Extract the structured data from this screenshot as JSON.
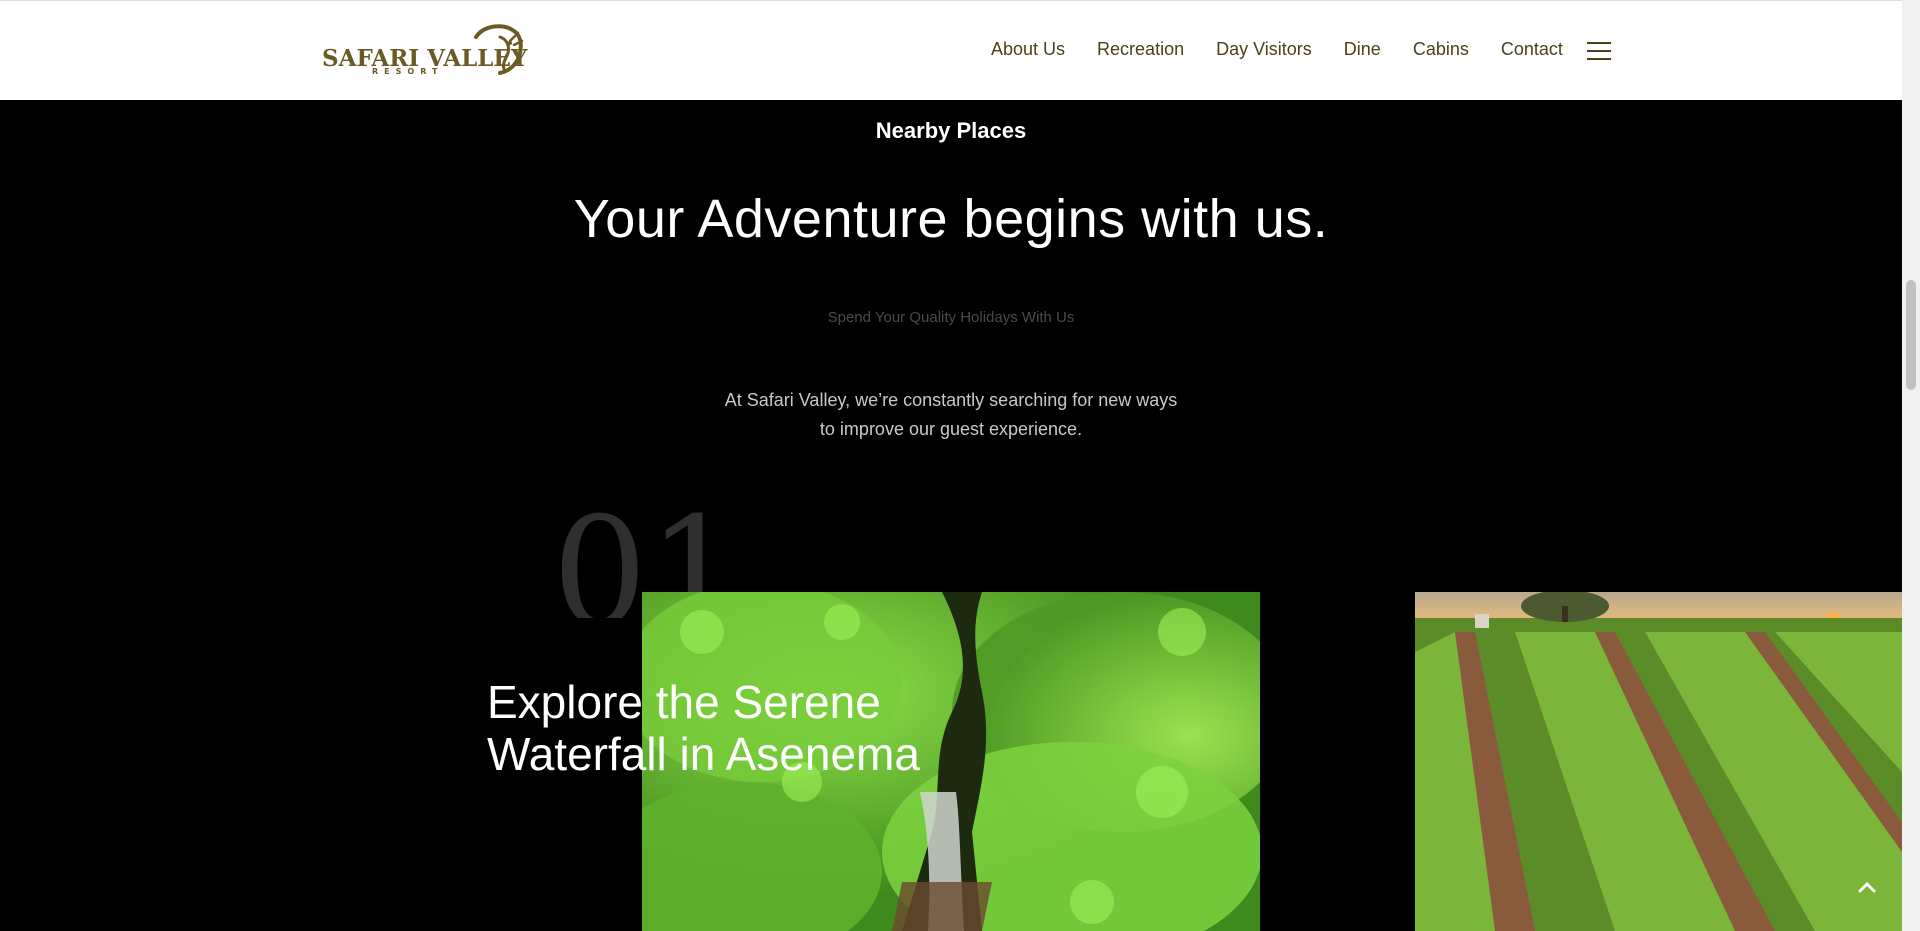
{
  "header": {
    "logo_text": "SAFARI VALLEY",
    "logo_sub": "RESORT",
    "nav": [
      {
        "label": "About Us"
      },
      {
        "label": "Recreation"
      },
      {
        "label": "Day Visitors"
      },
      {
        "label": "Dine"
      },
      {
        "label": "Cabins"
      },
      {
        "label": "Contact"
      }
    ],
    "menu_icon": "hamburger-menu-icon"
  },
  "section": {
    "eyebrow": "Nearby Places",
    "heading": "Your Adventure begins with us.",
    "tagline": "Spend Your Quality Holidays With Us",
    "description_line1": "At Safari Valley, we’re constantly searching for new ways",
    "description_line2": "to improve our guest experience."
  },
  "cards": [
    {
      "number": "01",
      "title_line1": "Explore the Serene",
      "title_line2": "Waterfall in Asenema",
      "image": "waterfall-forest-aerial"
    },
    {
      "image": "green-crop-field-sunset"
    }
  ],
  "colors": {
    "brand": "#6b5a23",
    "nav_text": "#4b4216",
    "background": "#000000"
  },
  "icons": {
    "scroll_to_top": "chevron-up-icon"
  }
}
